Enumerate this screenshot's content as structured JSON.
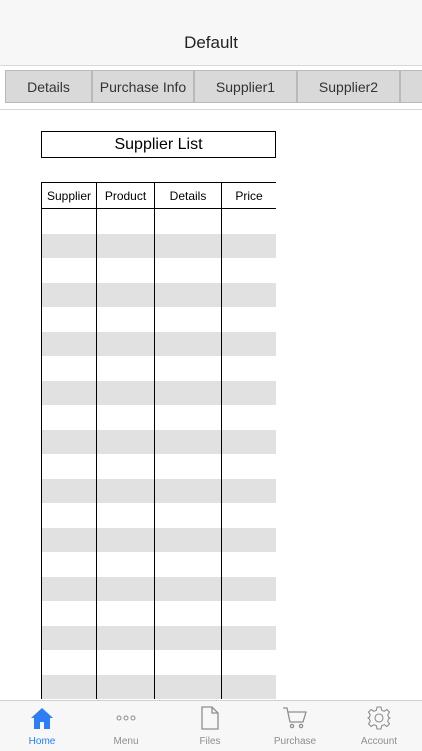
{
  "nav": {
    "title": "Default"
  },
  "tabs": [
    {
      "label": "Details"
    },
    {
      "label": "Purchase Info"
    },
    {
      "label": "Supplier1"
    },
    {
      "label": "Supplier2"
    },
    {
      "label": ""
    }
  ],
  "list": {
    "title": "Supplier List",
    "columns": [
      "Supplier",
      "Product",
      "Details",
      "Price"
    ],
    "rows": 20
  },
  "tabbar": {
    "items": [
      {
        "label": "Home",
        "icon": "home-icon",
        "active": true
      },
      {
        "label": "Menu",
        "icon": "menu-dots-icon",
        "active": false
      },
      {
        "label": "Files",
        "icon": "file-icon",
        "active": false
      },
      {
        "label": "Purchase",
        "icon": "cart-icon",
        "active": false
      },
      {
        "label": "Account",
        "icon": "gear-icon",
        "active": false
      }
    ]
  },
  "colors": {
    "accent": "#2f7df6",
    "inactive": "#8e8e93",
    "row_alt": "#e1e1e1",
    "tab_bg": "#d9d9d9"
  }
}
